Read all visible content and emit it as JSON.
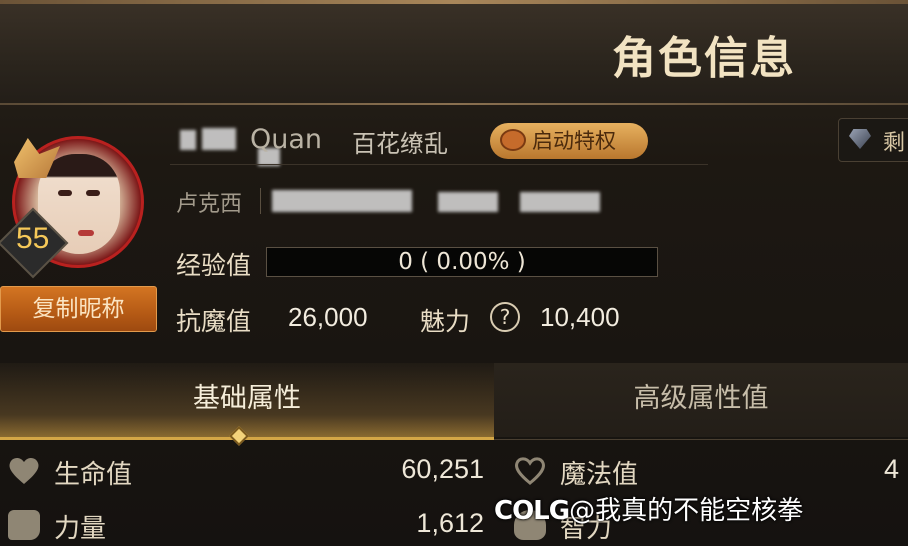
{
  "header": {
    "title": "角色信息"
  },
  "profile": {
    "level": "55",
    "copy_nickname_label": "复制昵称",
    "name_partial": "Quan",
    "title": "百花缭乱",
    "privilege_label": "启动特权",
    "right_chip_label": "剩",
    "server_prefix": "卢克西",
    "exp_label": "经验值",
    "exp_text": "0 ( 0.00% )",
    "exp_fraction": 0,
    "resistance_label": "抗魔值",
    "resistance_value": "26,000",
    "charm_label": "魅力",
    "charm_value": "10,400"
  },
  "tabs": [
    {
      "label": "基础属性",
      "active": true
    },
    {
      "label": "高级属性值",
      "active": false
    }
  ],
  "attributes": [
    {
      "icon": "heart-icon",
      "label": "生命值",
      "value": "60,251"
    },
    {
      "icon": "heart-outline-icon",
      "label": "魔法值",
      "value": "4"
    },
    {
      "icon": "fist-icon",
      "label": "力量",
      "value": "1,612"
    },
    {
      "icon": "brain-icon",
      "label": "智力",
      "value": ""
    }
  ],
  "watermark": {
    "brand": "COLG",
    "text": "@我真的不能空核拳"
  },
  "colors": {
    "accent_gold": "#d4a646",
    "button_orange": "#c8661b",
    "level_yellow": "#f6c959"
  }
}
